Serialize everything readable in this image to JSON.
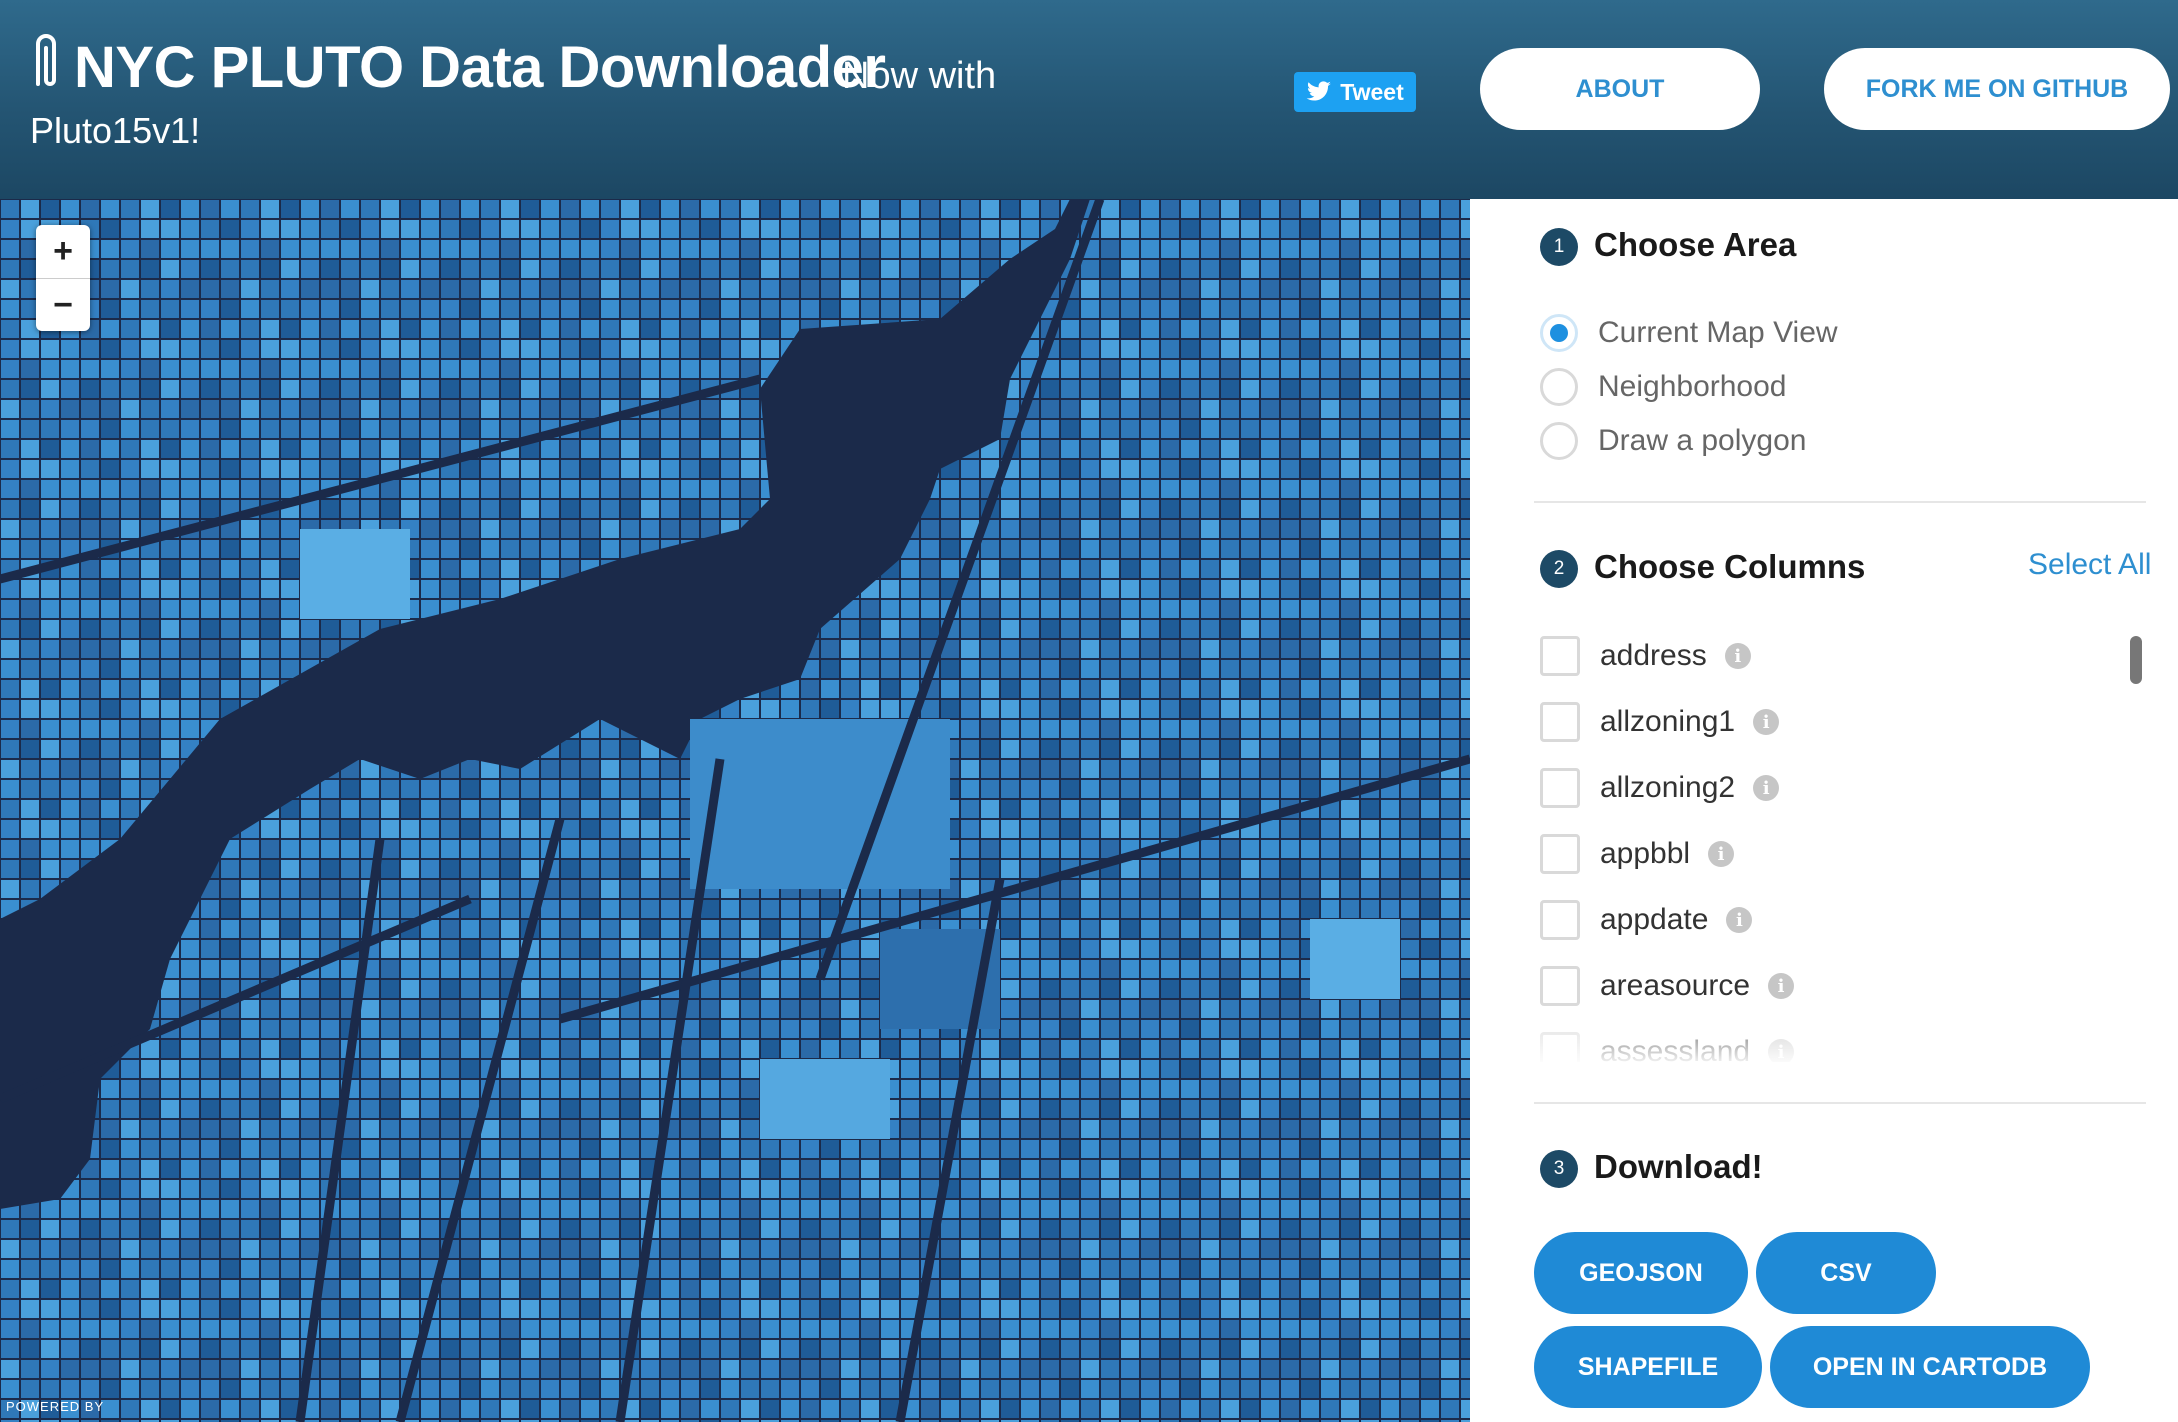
{
  "header": {
    "title": "NYC PLUTO Data Downloader",
    "subtitle": "Now with",
    "version": "Pluto15v1!",
    "tweet_label": "Tweet",
    "about_label": "ABOUT",
    "github_label": "FORK ME ON GITHUB"
  },
  "map": {
    "zoom_in": "+",
    "zoom_out": "−",
    "attribution": "POWERED BY"
  },
  "steps": {
    "area": {
      "number": "1",
      "title": "Choose Area",
      "options": [
        {
          "label": "Current Map View",
          "selected": true
        },
        {
          "label": "Neighborhood",
          "selected": false
        },
        {
          "label": "Draw a polygon",
          "selected": false
        }
      ]
    },
    "columns": {
      "number": "2",
      "title": "Choose Columns",
      "select_all": "Select All",
      "items": [
        "address",
        "allzoning1",
        "allzoning2",
        "appbbl",
        "appdate",
        "areasource",
        "assessland"
      ]
    },
    "download": {
      "number": "3",
      "title": "Download!",
      "buttons": [
        "GEOJSON",
        "CSV",
        "SHAPEFILE",
        "OPEN IN CARTODB"
      ]
    }
  },
  "colors": {
    "header_bg": "#245573",
    "accent": "#1f8ad6",
    "map_water": "#1b2a4a",
    "step_badge": "#1d4a66"
  },
  "icons": {
    "logo": "paperclip-icon",
    "tweet": "twitter-bird-icon",
    "info": "info-icon"
  }
}
